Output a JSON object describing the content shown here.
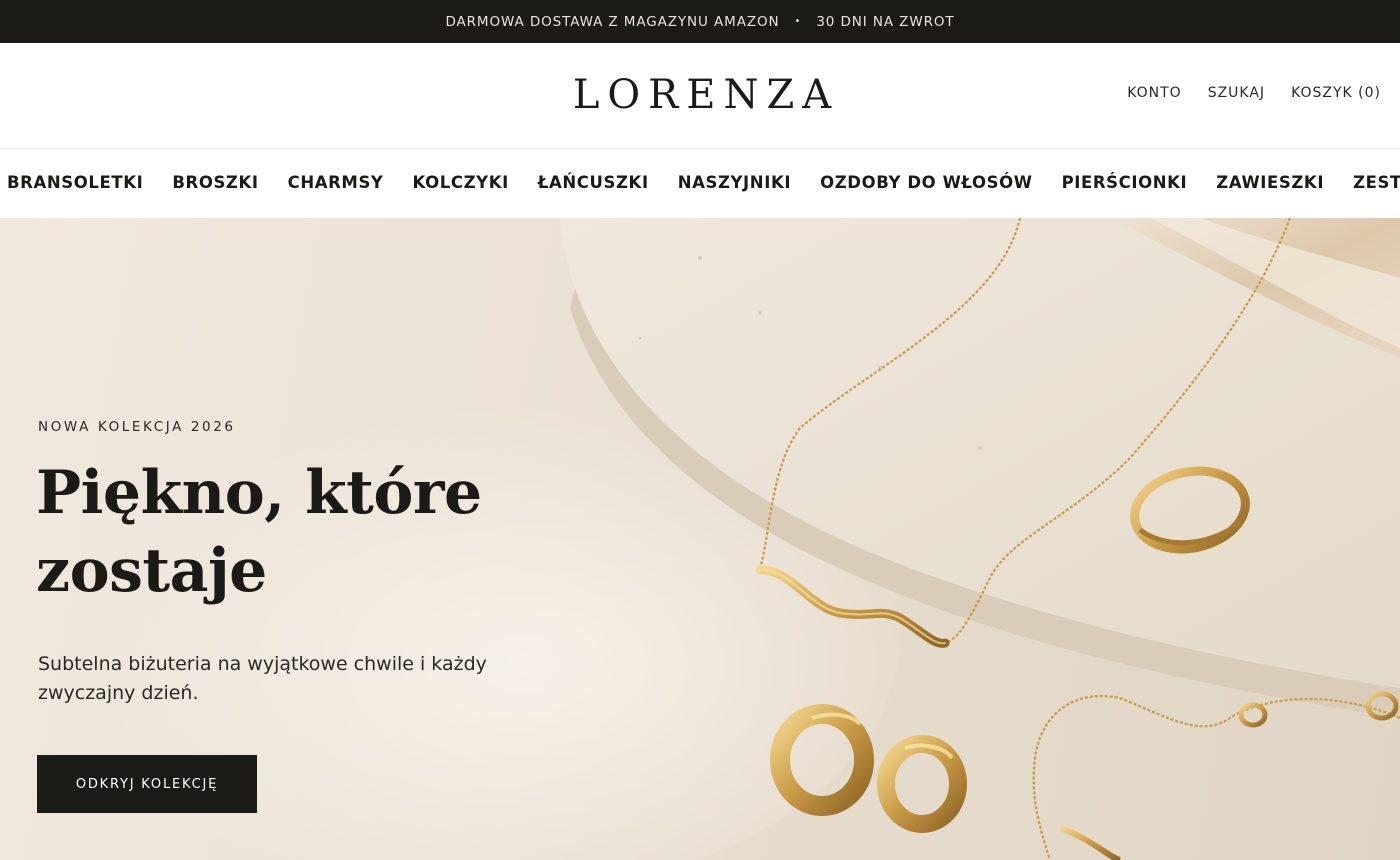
{
  "announcement": {
    "left": "DARMOWA DOSTAWA Z MAGAZYNU AMAZON",
    "separator": "•",
    "right": "30 DNI NA ZWROT"
  },
  "header": {
    "logo": "LORENZA",
    "account": "KONTO",
    "search": "SZUKAJ",
    "cart": "KOSZYK (0)"
  },
  "nav": {
    "items": [
      "BRANSOLETKI",
      "BROSZKI",
      "CHARMSY",
      "KOLCZYKI",
      "ŁAŃCUSZKI",
      "NASZYJNIKI",
      "OZDOBY DO WŁOSÓW",
      "PIERŚCIONKI",
      "ZAWIESZKI",
      "ZESTAWY"
    ]
  },
  "hero": {
    "eyebrow": "NOWA KOLEKCJA 2026",
    "title_line1": "Piękno, które",
    "title_line2": "zostaje",
    "subtitle_line1": "Subtelna biżuteria na wyjątkowe chwile i każdy",
    "subtitle_line2": "zwyczajny dzień.",
    "cta": "ODKRYJ KOLEKCJĘ"
  },
  "colors": {
    "dark": "#1c1a17",
    "gold": "#c9a04e",
    "cream": "#efe8dd",
    "stone": "#ece4d6"
  }
}
